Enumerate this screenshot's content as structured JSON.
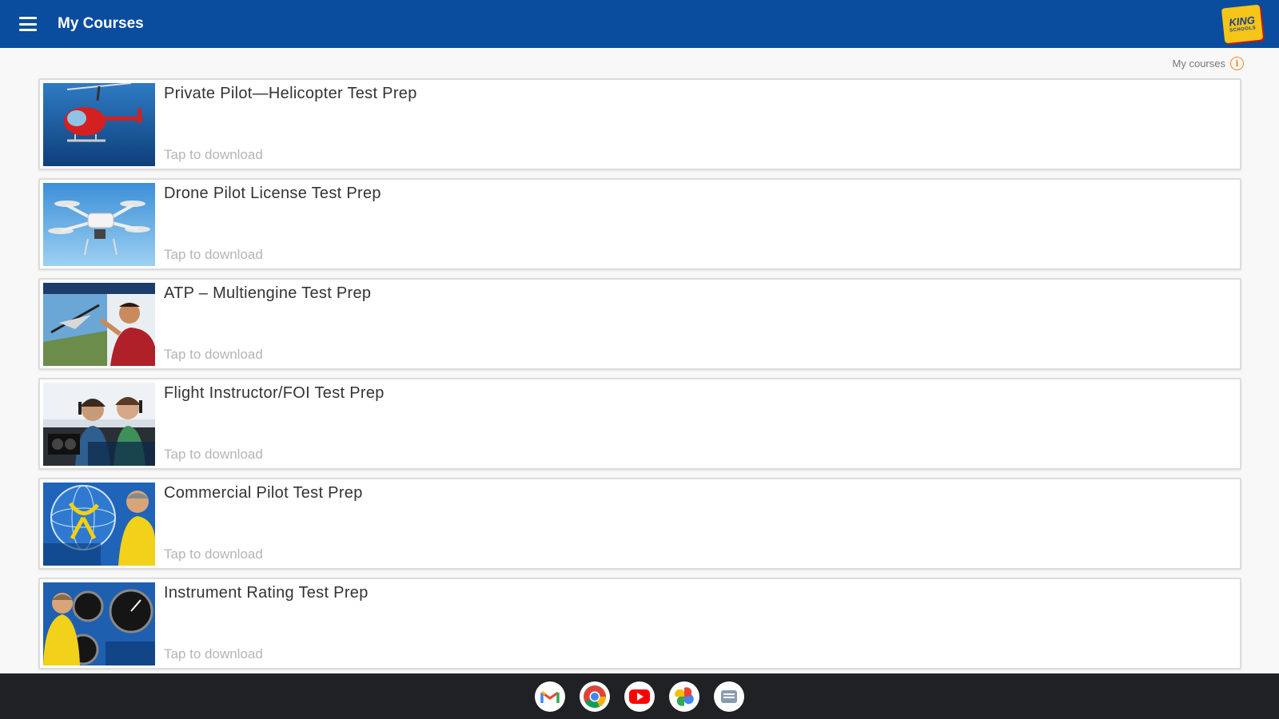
{
  "appbar": {
    "title": "My Courses",
    "menu_icon": "hamburger-menu-icon",
    "logo_text_top": "KING",
    "logo_text_bottom": "SCHOOLS"
  },
  "header": {
    "link_label": "My courses",
    "info_icon": "info-icon",
    "info_glyph": "i"
  },
  "courses": [
    {
      "title": "Private Pilot—Helicopter Test Prep",
      "status": "Tap to download",
      "thumb": "helicopter-thumbnail"
    },
    {
      "title": "Drone Pilot License Test Prep",
      "status": "Tap to download",
      "thumb": "drone-thumbnail"
    },
    {
      "title": "ATP – Multiengine Test Prep",
      "status": "Tap to download",
      "thumb": "atp-instructor-thumbnail"
    },
    {
      "title": "Flight Instructor/FOI Test Prep",
      "status": "Tap to download",
      "thumb": "cockpit-thumbnail"
    },
    {
      "title": "Commercial Pilot Test Prep",
      "status": "Tap to download",
      "thumb": "coriolis-force-thumbnail"
    },
    {
      "title": "Instrument Rating Test Prep",
      "status": "Tap to download",
      "thumb": "instruments-thumbnail"
    }
  ],
  "taskbar": {
    "apps": [
      "gmail-icon",
      "chrome-icon",
      "youtube-icon",
      "photos-icon",
      "messages-icon"
    ]
  },
  "colors": {
    "appbar": "#0a4c9e",
    "accent_info": "#f08a24",
    "taskbar": "#202124"
  }
}
